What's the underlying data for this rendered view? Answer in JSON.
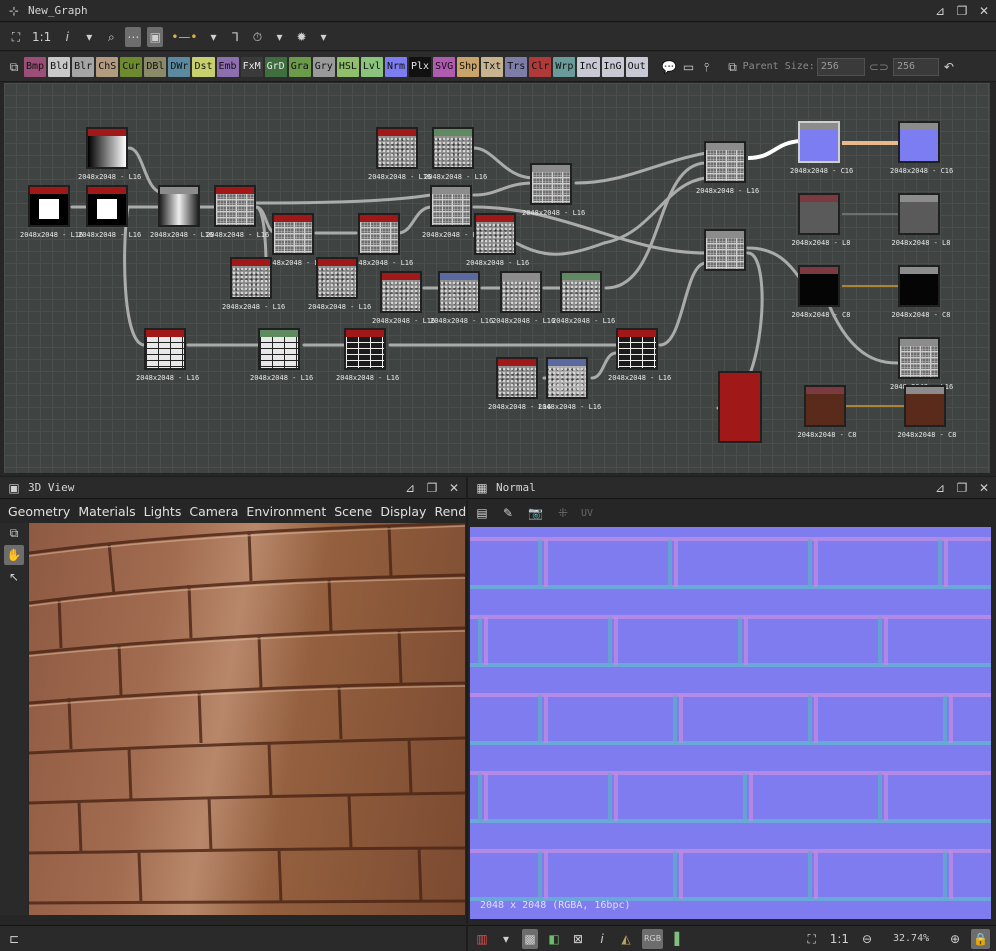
{
  "graph_panel": {
    "title": "New_Graph",
    "toolbar": {
      "zoom_label": "1:1",
      "info_label": "i"
    },
    "atoms": [
      {
        "label": "Bmp",
        "color": "#9b4e76"
      },
      {
        "label": "Bld",
        "color": "#c9c9c9"
      },
      {
        "label": "Blr",
        "color": "#a5a5a5"
      },
      {
        "label": "ChS",
        "color": "#b39b7f"
      },
      {
        "label": "Cur",
        "color": "#6d8a2e"
      },
      {
        "label": "DBl",
        "color": "#8a8a68"
      },
      {
        "label": "DWr",
        "color": "#5b8aa0"
      },
      {
        "label": "Dst",
        "color": "#c7d06c"
      },
      {
        "label": "Emb",
        "color": "#8d6fb0"
      },
      {
        "label": "FxM",
        "color": "#3a3a3a"
      },
      {
        "label": "GrD",
        "color": "#3e6e3e"
      },
      {
        "label": "Gra",
        "color": "#6a9a4a"
      },
      {
        "label": "Gry",
        "color": "#9a9a9a"
      },
      {
        "label": "HSL",
        "color": "#8fbf6a"
      },
      {
        "label": "Lvl",
        "color": "#8bc37e"
      },
      {
        "label": "Nrm",
        "color": "#7d7df2"
      },
      {
        "label": "Plx",
        "color": "#111111"
      },
      {
        "label": "SVG",
        "color": "#b05ab0"
      },
      {
        "label": "Shp",
        "color": "#c9a46a"
      },
      {
        "label": "Txt",
        "color": "#c7b48f"
      },
      {
        "label": "Trs",
        "color": "#7d7da8"
      },
      {
        "label": "Clr",
        "color": "#b03a3a"
      },
      {
        "label": "Wrp",
        "color": "#6b9a9a"
      },
      {
        "label": "InC",
        "color": "#c9c9d6"
      },
      {
        "label": "InG",
        "color": "#c9c9d6"
      },
      {
        "label": "Out",
        "color": "#c9c9d6"
      }
    ],
    "parent_size_label": "Parent Size:",
    "parent_size_w": "256",
    "parent_size_h": "256",
    "node_label": "2048x2048 - L16",
    "node_label_c8": "2048x2048 - C8",
    "node_label_c16": "2048x2048 - C16",
    "node_label_l8": "2048x2048 - L8"
  },
  "view3d_panel": {
    "title": "3D View",
    "menu": [
      "Geometry",
      "Materials",
      "Lights",
      "Camera",
      "Environment",
      "Scene",
      "Display",
      "Renderer"
    ]
  },
  "normal_panel": {
    "title": "Normal",
    "uv_label": "UV",
    "image_info": "2048 x 2048 (RGBA, 16bpc)",
    "zoom_ratio": "1:1",
    "zoom_percent": "32.74%"
  },
  "colors": {
    "graph_bg": "#3f4442",
    "brick_brown": "#a26c50",
    "normal_blue": "#7f7cf0",
    "node_red": "#a01818",
    "node_green": "#5f8a5f",
    "node_blue": "#5a6aa0"
  }
}
